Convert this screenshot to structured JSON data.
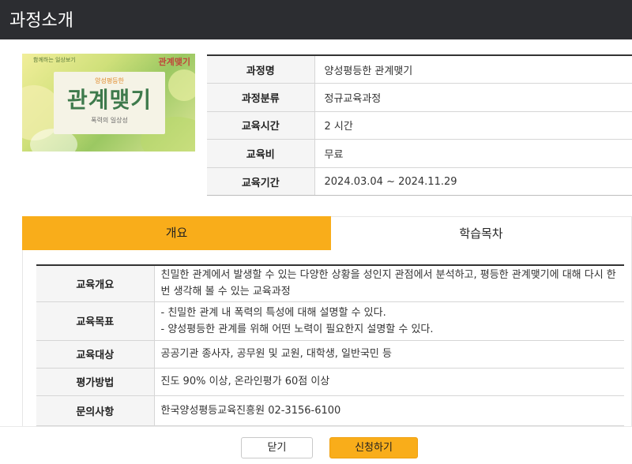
{
  "header": {
    "title": "과정소개"
  },
  "thumbnail": {
    "corner_top": "함께하는 일상보기",
    "corner_logo": "관계맺기",
    "subtitle": "양성평등한",
    "main_title": "관계맺기",
    "footer": "폭력의 일상성"
  },
  "course_info": [
    {
      "label": "과정명",
      "value": "양성평등한 관계맺기"
    },
    {
      "label": "과정분류",
      "value": "정규교육과정"
    },
    {
      "label": "교육시간",
      "value": "2 시간"
    },
    {
      "label": "교육비",
      "value": "무료"
    },
    {
      "label": "교육기간",
      "value": "2024.03.04 ~ 2024.11.29"
    }
  ],
  "tabs": [
    {
      "label": "개요",
      "active": true
    },
    {
      "label": "학습목차",
      "active": false
    }
  ],
  "overview": [
    {
      "label": "교육개요",
      "lines": [
        "친밀한 관계에서 발생할 수 있는 다양한 상황을 성인지 관점에서 분석하고, 평등한 관계맺기에 대해 다시 한번 생각해 볼 수 있는 교육과정"
      ]
    },
    {
      "label": "교육목표",
      "lines": [
        "- 친밀한 관계 내 폭력의 특성에 대해 설명할 수 있다.",
        "- 양성평등한 관계를 위해 어떤 노력이 필요한지 설명할 수 있다."
      ]
    },
    {
      "label": "교육대상",
      "lines": [
        "공공기관 종사자, 공무원 및 교원, 대학생, 일반국민 등"
      ]
    },
    {
      "label": "평가방법",
      "lines": [
        "진도 90% 이상, 온라인평가 60점 이상"
      ]
    },
    {
      "label": "문의사항",
      "lines": [
        "한국양성평등교육진흥원 02-3156-6100"
      ]
    }
  ],
  "buttons": {
    "close": "닫기",
    "apply": "신청하기"
  },
  "colors": {
    "accent": "#f9ad1a",
    "header_bg": "#2c2d31",
    "label_bg": "#f5f5f5"
  }
}
